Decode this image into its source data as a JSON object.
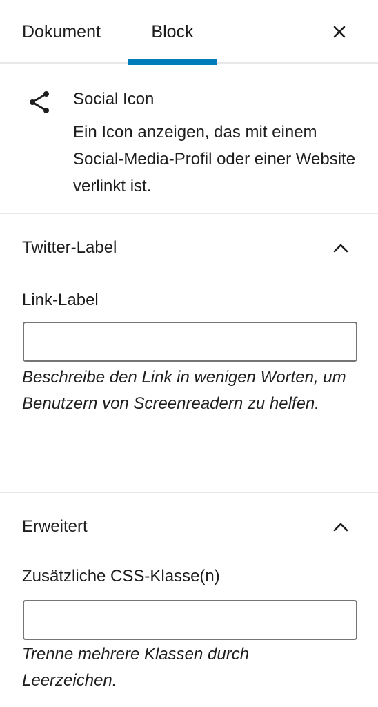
{
  "tabs": {
    "dokument": "Dokument",
    "block": "Block",
    "active": "Block"
  },
  "close_icon": "close-icon",
  "block_card": {
    "icon": "share-icon",
    "title": "Social Icon",
    "description": "Ein Icon anzeigen, das mit einem Social-Media-Profil oder einer Website verlinkt ist."
  },
  "panels": [
    {
      "title": "Twitter-Label",
      "expanded": true,
      "field_label": "Link-Label",
      "field_value": "",
      "help": "Beschreibe den Link in wenigen Worten, um Benutzern von Screenreadern zu helfen."
    },
    {
      "title": "Erweitert",
      "expanded": true,
      "field_label": "Zusätzliche CSS-Klasse(n)",
      "field_value": "",
      "help": "Trenne mehrere Klassen durch Leerzeichen."
    }
  ],
  "colors": {
    "accent": "#007cba",
    "text": "#1e1e1e",
    "border": "#757575",
    "divider": "#e8e8e8"
  }
}
